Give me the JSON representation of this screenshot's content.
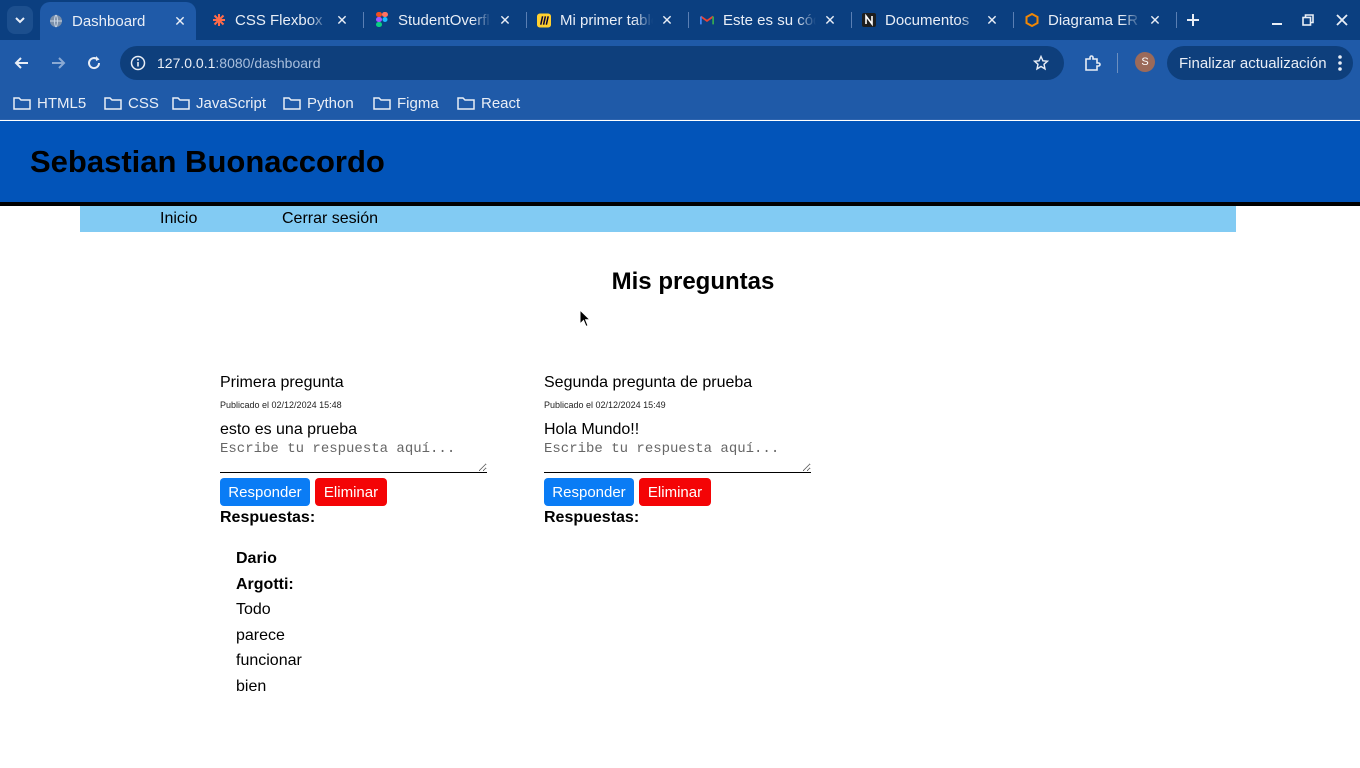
{
  "browser": {
    "tabs": [
      {
        "title": "Dashboard",
        "icon": "globe-icon",
        "active": true
      },
      {
        "title": "CSS Flexbox Layout Guide",
        "icon": "css-tricks-icon",
        "active": false
      },
      {
        "title": "StudentOverflow",
        "icon": "figma-icon",
        "active": false
      },
      {
        "title": "Mi primer tablero",
        "icon": "miro-icon",
        "active": false
      },
      {
        "title": "Este es su código",
        "icon": "gmail-icon",
        "active": false
      },
      {
        "title": "Documentos",
        "icon": "notion-icon",
        "active": false
      },
      {
        "title": "Diagrama ER",
        "icon": "drawio-icon",
        "active": false
      }
    ],
    "url_host": "127.0.0.1",
    "url_rest": ":8080/dashboard",
    "profile_initial": "S",
    "update_label": "Finalizar actualización",
    "bookmarks": [
      "HTML5",
      "CSS",
      "JavaScript",
      "Python",
      "Figma",
      "React"
    ]
  },
  "site": {
    "title": "Sebastian Buonaccordo",
    "nav": {
      "home": "Inicio",
      "logout": "Cerrar sesión"
    },
    "page_heading": "Mis preguntas",
    "colors": {
      "header": "#0254b9",
      "nav": "#82cbf3",
      "reply": "#0a7cf5",
      "delete": "#f40406"
    }
  },
  "questions": [
    {
      "title": "Primera pregunta",
      "date": "Publicado el 02/12/2024 15:48",
      "body": "esto es una prueba",
      "answer_placeholder": "Escribe tu respuesta aquí...",
      "reply_label": "Responder",
      "delete_label": "Eliminar",
      "responses_label": "Respuestas:",
      "responses": [
        {
          "author": "Dario Argotti:",
          "text": "Todo parece funcionar bien"
        }
      ]
    },
    {
      "title": "Segunda pregunta de prueba",
      "date": "Publicado el 02/12/2024 15:49",
      "body": "Hola Mundo!!",
      "answer_placeholder": "Escribe tu respuesta aquí...",
      "reply_label": "Responder",
      "delete_label": "Eliminar",
      "responses_label": "Respuestas:",
      "responses": []
    }
  ]
}
